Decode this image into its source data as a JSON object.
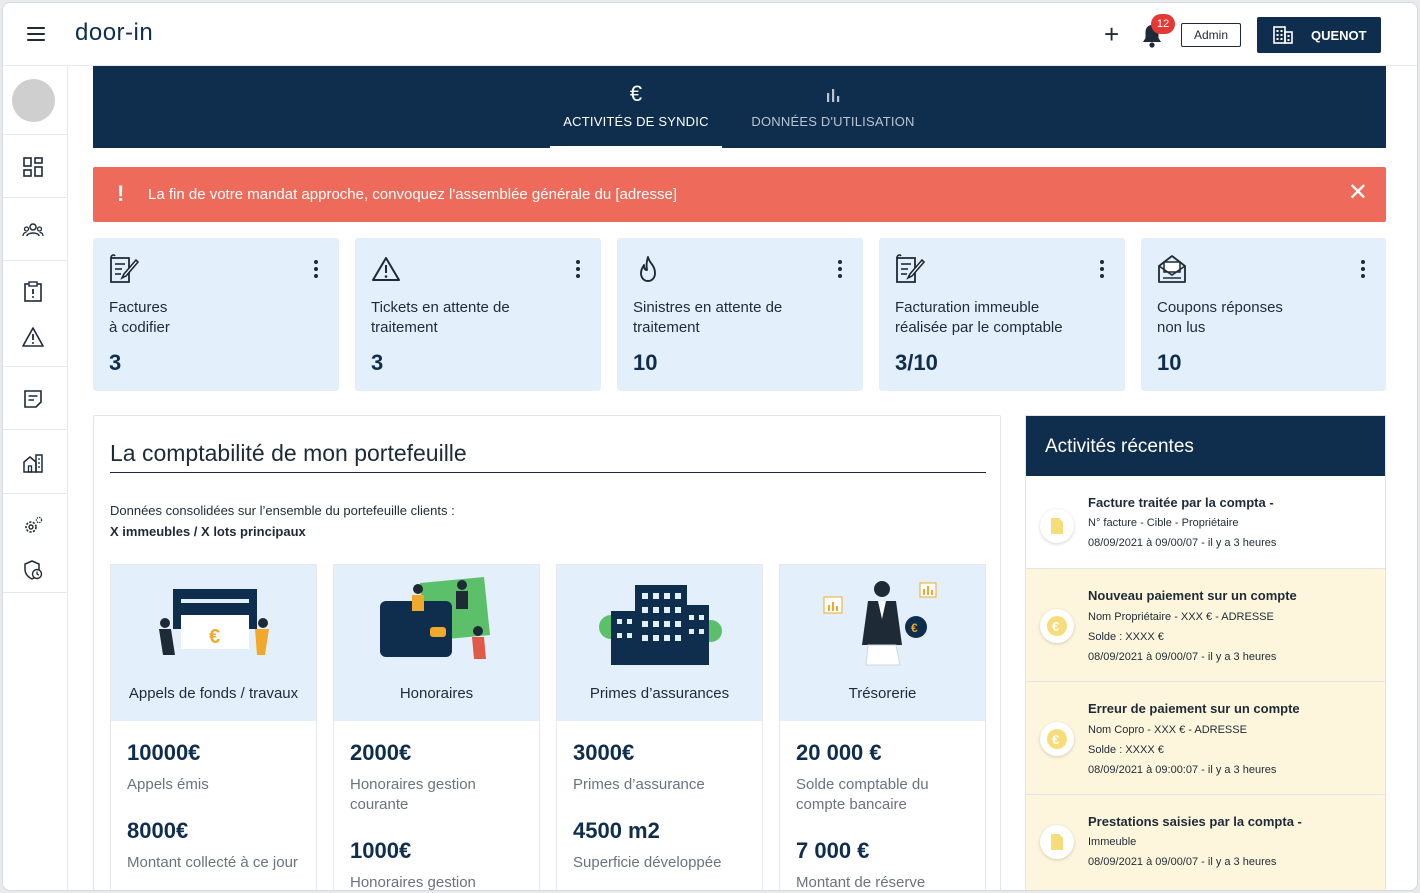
{
  "header": {
    "logo": "door-in",
    "notification_count": "12",
    "admin_label": "Admin",
    "company_label": "QUENOT"
  },
  "tabs": [
    {
      "label": "ACTIVITÉS DE SYNDIC",
      "icon": "euro-icon",
      "active": true
    },
    {
      "label": "DONNÉES D'UTILISATION",
      "icon": "bar-chart-icon",
      "active": false
    }
  ],
  "alert": {
    "message": "La fin de votre mandat approche, convoquez l'assemblée générale du [adresse]"
  },
  "stats": [
    {
      "label_line1": "Factures",
      "label_line2": "à codifier",
      "value": "3",
      "icon": "invoice-edit-icon"
    },
    {
      "label_line1": "Tickets en attente de",
      "label_line2": "traitement",
      "value": "3",
      "icon": "warning-icon"
    },
    {
      "label_line1": "Sinistres en attente de",
      "label_line2": "traitement",
      "value": "10",
      "icon": "flame-icon"
    },
    {
      "label_line1": "Facturation immeuble",
      "label_line2": "réalisée par le comptable",
      "value": "3/10",
      "icon": "invoice-edit-icon"
    },
    {
      "label_line1": "Coupons réponses",
      "label_line2": "non lus",
      "value": "10",
      "icon": "mail-stack-icon"
    }
  ],
  "portfolio": {
    "title": "La comptabilité de mon portefeuille",
    "desc_line1": "Données consolidées sur l’ensemble du portefeuille clients :",
    "desc_line2": "X immeubles / X lots principaux",
    "cards": [
      {
        "name": "Appels de fonds / travaux",
        "v1": "10000€",
        "l1": "Appels émis",
        "v2": "8000€",
        "l2": "Montant collecté à ce jour"
      },
      {
        "name": "Honoraires",
        "v1": "2000€",
        "l1": "Honoraires gestion courante",
        "v2": "1000€",
        "l2": "Honoraires gestion"
      },
      {
        "name": "Primes d’assurances",
        "v1": "3000€",
        "l1": "Primes d’assurance",
        "v2": "4500 m2",
        "l2": "Superficie développée"
      },
      {
        "name": "Trésorerie",
        "v1": "20 000 €",
        "l1": "Solde comptable du compte bancaire",
        "v2": "7 000 €",
        "l2": "Montant de réserve"
      }
    ]
  },
  "recent": {
    "title": "Activités récentes",
    "items": [
      {
        "title": "Facture traitée par la compta  -",
        "line1": "N° facture - Cible - Propriétaire",
        "line2": "08/09/2021 à 09/00/07 - il y a 3 heures",
        "line3": "",
        "icon": "document-icon",
        "style": "white"
      },
      {
        "title": "Nouveau paiement sur un compte",
        "line1": "Nom Propriétaire - XXX € - ADRESSE",
        "line2": "Solde : XXXX €",
        "line3": "08/09/2021 à 09/00/07 - il y a 3 heures",
        "icon": "euro-coin-icon",
        "style": "yellow"
      },
      {
        "title": "Erreur de paiement sur un compte",
        "line1": "Nom Copro - XXX € - ADRESSE",
        "line2": "Solde : XXXX €",
        "line3": "08/09/2021 à 09:00:07 - il y a 3 heures",
        "icon": "euro-coin-icon",
        "style": "yellow"
      },
      {
        "title": "Prestations saisies par la compta  -",
        "line1": "Immeuble",
        "line2": "08/09/2021 à 09/00/07 - il y a 3 heures",
        "line3": "",
        "icon": "document-icon",
        "style": "yellow"
      }
    ]
  },
  "colors": {
    "navy": "#0f2d4d",
    "alert": "#ee6b5c",
    "card_bg": "#e3f0fb",
    "highlight": "#fdf6dc"
  }
}
